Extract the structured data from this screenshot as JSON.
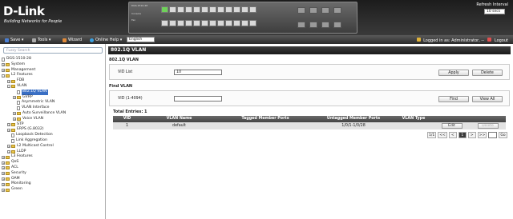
{
  "header": {
    "logo": "D-Link",
    "tagline": "Building Networks for People",
    "device_model": "DGS-1510-28",
    "console_label": "Console",
    "fan_label": "Fan",
    "refresh_label": "Refresh Interval",
    "refresh_value": "10 secs"
  },
  "toolbar": {
    "save": "Save",
    "tools": "Tools",
    "wizard": "Wizard",
    "online_help": "Online Help",
    "language": "English",
    "logged_in": "Logged in as: Administrator, --",
    "logout": "Logout"
  },
  "sidebar": {
    "search_placeholder": "Fuzzy Search",
    "items": [
      {
        "label": "DGS-1510-28",
        "level": 0,
        "kind": "root"
      },
      {
        "label": "System",
        "level": 0,
        "kind": "folder"
      },
      {
        "label": "Management",
        "level": 0,
        "kind": "folder"
      },
      {
        "label": "L2 Features",
        "level": 0,
        "kind": "folder-open"
      },
      {
        "label": "FDB",
        "level": 1,
        "kind": "folder"
      },
      {
        "label": "VLAN",
        "level": 1,
        "kind": "folder-open"
      },
      {
        "label": "802.1Q VLAN",
        "level": 2,
        "kind": "doc",
        "selected": true
      },
      {
        "label": "GVRP",
        "level": 2,
        "kind": "folder"
      },
      {
        "label": "Asymmetric VLAN",
        "level": 2,
        "kind": "doc"
      },
      {
        "label": "VLAN Interface",
        "level": 2,
        "kind": "doc"
      },
      {
        "label": "Auto Surveillance VLAN",
        "level": 2,
        "kind": "folder"
      },
      {
        "label": "Voice VLAN",
        "level": 2,
        "kind": "folder"
      },
      {
        "label": "STP",
        "level": 1,
        "kind": "folder"
      },
      {
        "label": "ERPS (G.8032)",
        "level": 1,
        "kind": "folder"
      },
      {
        "label": "Loopback Detection",
        "level": 1,
        "kind": "doc"
      },
      {
        "label": "Link Aggregation",
        "level": 1,
        "kind": "doc"
      },
      {
        "label": "L2 Multicast Control",
        "level": 1,
        "kind": "folder"
      },
      {
        "label": "LLDP",
        "level": 1,
        "kind": "folder"
      },
      {
        "label": "L3 Features",
        "level": 0,
        "kind": "folder"
      },
      {
        "label": "QoS",
        "level": 0,
        "kind": "folder"
      },
      {
        "label": "ACL",
        "level": 0,
        "kind": "folder"
      },
      {
        "label": "Security",
        "level": 0,
        "kind": "folder"
      },
      {
        "label": "OAM",
        "level": 0,
        "kind": "folder"
      },
      {
        "label": "Monitoring",
        "level": 0,
        "kind": "folder"
      },
      {
        "label": "Green",
        "level": 0,
        "kind": "folder"
      }
    ]
  },
  "main": {
    "title": "802.1Q VLAN",
    "section1": "802.1Q VLAN",
    "vid_list_label": "VID List",
    "vid_list_value": "10",
    "apply": "Apply",
    "delete": "Delete",
    "section2": "Find VLAN",
    "find_label": "VID (1-4094)",
    "find_value": "",
    "find": "Find",
    "view_all": "View All",
    "total": "Total Entries: 1",
    "table": {
      "headers": [
        "VID",
        "VLAN Name",
        "Tagged Member Ports",
        "Untagged Member Ports",
        "VLAN Type",
        ""
      ],
      "rows": [
        {
          "vid": "1",
          "name": "default",
          "tagged": "",
          "untagged": "1/0/1-1/0/28",
          "type": "",
          "edit": "Edit",
          "delete": "Delete"
        }
      ]
    },
    "pager": {
      "page_info": "1/1",
      "first": "<<",
      "prev": "<",
      "current": "1",
      "next": ">",
      "last": ">>",
      "go_value": "",
      "go": "Go"
    }
  },
  "colors": {
    "selected": "#3a6fc4",
    "port_up": "#6fd15a",
    "header_bg": "#2a2a2a"
  }
}
